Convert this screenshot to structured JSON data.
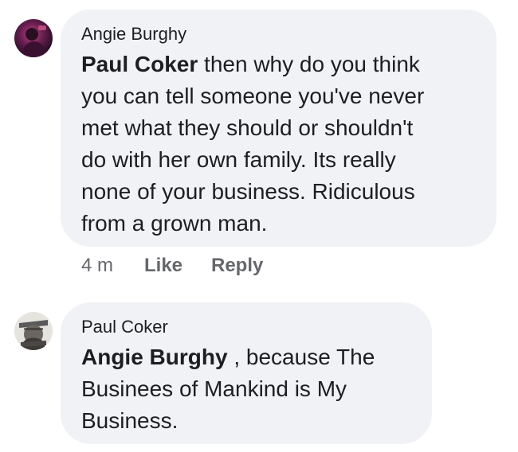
{
  "comments": [
    {
      "author": "Angie Burghy",
      "mention": "Paul Coker",
      "lines": [
        " then why do you think",
        "you can tell someone you've never",
        "met what they should or shouldn't",
        "do with her own family. Its really",
        "none of your business. Ridiculous",
        "from a grown man."
      ],
      "timestamp": "4 m",
      "like_label": "Like",
      "reply_label": "Reply",
      "avatar_icon": "profile-photo-icon"
    },
    {
      "author": "Paul Coker",
      "mention": "Angie Burghy",
      "lines": [
        " , because The",
        "Businees of Mankind is My",
        "Business."
      ],
      "avatar_icon": "profile-photo-icon"
    }
  ],
  "colors": {
    "bubble": "#f0f2f5",
    "text": "#1c1e21",
    "meta": "#65676b"
  }
}
